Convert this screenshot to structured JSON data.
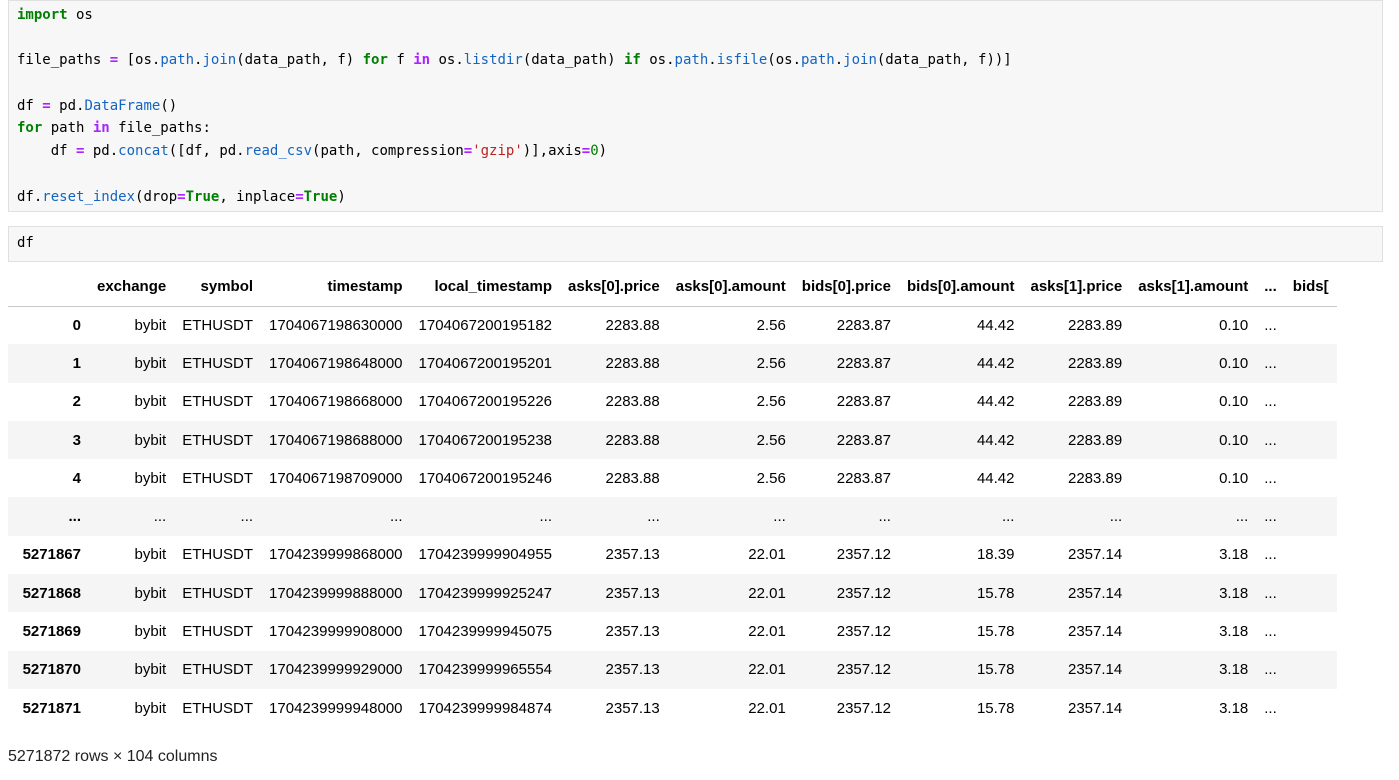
{
  "code_cell_1": {
    "lines": [
      [
        {
          "t": "import",
          "c": "k"
        },
        {
          "t": " os",
          "c": "p"
        }
      ],
      [],
      [
        {
          "t": "file_paths ",
          "c": "p"
        },
        {
          "t": "=",
          "c": "o"
        },
        {
          "t": " [os.",
          "c": "p"
        },
        {
          "t": "path",
          "c": "n"
        },
        {
          "t": ".",
          "c": "p"
        },
        {
          "t": "join",
          "c": "n"
        },
        {
          "t": "(data_path, f) ",
          "c": "p"
        },
        {
          "t": "for",
          "c": "k"
        },
        {
          "t": " f ",
          "c": "p"
        },
        {
          "t": "in",
          "c": "o"
        },
        {
          "t": " os.",
          "c": "p"
        },
        {
          "t": "listdir",
          "c": "n"
        },
        {
          "t": "(data_path) ",
          "c": "p"
        },
        {
          "t": "if",
          "c": "k"
        },
        {
          "t": " os.",
          "c": "p"
        },
        {
          "t": "path",
          "c": "n"
        },
        {
          "t": ".",
          "c": "p"
        },
        {
          "t": "isfile",
          "c": "n"
        },
        {
          "t": "(os.",
          "c": "p"
        },
        {
          "t": "path",
          "c": "n"
        },
        {
          "t": ".",
          "c": "p"
        },
        {
          "t": "join",
          "c": "n"
        },
        {
          "t": "(data_path, f))]",
          "c": "p"
        }
      ],
      [],
      [
        {
          "t": "df ",
          "c": "p"
        },
        {
          "t": "=",
          "c": "o"
        },
        {
          "t": " pd.",
          "c": "p"
        },
        {
          "t": "DataFrame",
          "c": "n"
        },
        {
          "t": "()",
          "c": "p"
        }
      ],
      [
        {
          "t": "for",
          "c": "k"
        },
        {
          "t": " path ",
          "c": "p"
        },
        {
          "t": "in",
          "c": "o"
        },
        {
          "t": " file_paths:",
          "c": "p"
        }
      ],
      [
        {
          "t": "    df ",
          "c": "p"
        },
        {
          "t": "=",
          "c": "o"
        },
        {
          "t": " pd.",
          "c": "p"
        },
        {
          "t": "concat",
          "c": "n"
        },
        {
          "t": "([df, pd.",
          "c": "p"
        },
        {
          "t": "read_csv",
          "c": "n"
        },
        {
          "t": "(path, compression",
          "c": "p"
        },
        {
          "t": "=",
          "c": "o"
        },
        {
          "t": "'gzip'",
          "c": "s"
        },
        {
          "t": ")],axis",
          "c": "p"
        },
        {
          "t": "=",
          "c": "o"
        },
        {
          "t": "0",
          "c": "nu"
        },
        {
          "t": ")",
          "c": "p"
        }
      ],
      [],
      [
        {
          "t": "df.",
          "c": "p"
        },
        {
          "t": "reset_index",
          "c": "n"
        },
        {
          "t": "(drop",
          "c": "p"
        },
        {
          "t": "=",
          "c": "o"
        },
        {
          "t": "True",
          "c": "k"
        },
        {
          "t": ", inplace",
          "c": "p"
        },
        {
          "t": "=",
          "c": "o"
        },
        {
          "t": "True",
          "c": "k"
        },
        {
          "t": ")",
          "c": "p"
        }
      ]
    ]
  },
  "code_cell_2": {
    "source": "df"
  },
  "dataframe": {
    "columns": [
      "",
      "exchange",
      "symbol",
      "timestamp",
      "local_timestamp",
      "asks[0].price",
      "asks[0].amount",
      "bids[0].price",
      "bids[0].amount",
      "asks[1].price",
      "asks[1].amount",
      "...",
      "bids["
    ],
    "rows": [
      [
        "0",
        "bybit",
        "ETHUSDT",
        "1704067198630000",
        "1704067200195182",
        "2283.88",
        "2.56",
        "2283.87",
        "44.42",
        "2283.89",
        "0.10",
        "..."
      ],
      [
        "1",
        "bybit",
        "ETHUSDT",
        "1704067198648000",
        "1704067200195201",
        "2283.88",
        "2.56",
        "2283.87",
        "44.42",
        "2283.89",
        "0.10",
        "..."
      ],
      [
        "2",
        "bybit",
        "ETHUSDT",
        "1704067198668000",
        "1704067200195226",
        "2283.88",
        "2.56",
        "2283.87",
        "44.42",
        "2283.89",
        "0.10",
        "..."
      ],
      [
        "3",
        "bybit",
        "ETHUSDT",
        "1704067198688000",
        "1704067200195238",
        "2283.88",
        "2.56",
        "2283.87",
        "44.42",
        "2283.89",
        "0.10",
        "..."
      ],
      [
        "4",
        "bybit",
        "ETHUSDT",
        "1704067198709000",
        "1704067200195246",
        "2283.88",
        "2.56",
        "2283.87",
        "44.42",
        "2283.89",
        "0.10",
        "..."
      ],
      [
        "...",
        "...",
        "...",
        "...",
        "...",
        "...",
        "...",
        "...",
        "...",
        "...",
        "...",
        "..."
      ],
      [
        "5271867",
        "bybit",
        "ETHUSDT",
        "1704239999868000",
        "1704239999904955",
        "2357.13",
        "22.01",
        "2357.12",
        "18.39",
        "2357.14",
        "3.18",
        "..."
      ],
      [
        "5271868",
        "bybit",
        "ETHUSDT",
        "1704239999888000",
        "1704239999925247",
        "2357.13",
        "22.01",
        "2357.12",
        "15.78",
        "2357.14",
        "3.18",
        "..."
      ],
      [
        "5271869",
        "bybit",
        "ETHUSDT",
        "1704239999908000",
        "1704239999945075",
        "2357.13",
        "22.01",
        "2357.12",
        "15.78",
        "2357.14",
        "3.18",
        "..."
      ],
      [
        "5271870",
        "bybit",
        "ETHUSDT",
        "1704239999929000",
        "1704239999965554",
        "2357.13",
        "22.01",
        "2357.12",
        "15.78",
        "2357.14",
        "3.18",
        "..."
      ],
      [
        "5271871",
        "bybit",
        "ETHUSDT",
        "1704239999948000",
        "1704239999984874",
        "2357.13",
        "22.01",
        "2357.12",
        "15.78",
        "2357.14",
        "3.18",
        "..."
      ]
    ],
    "shape_text": "5271872 rows × 104 columns"
  }
}
